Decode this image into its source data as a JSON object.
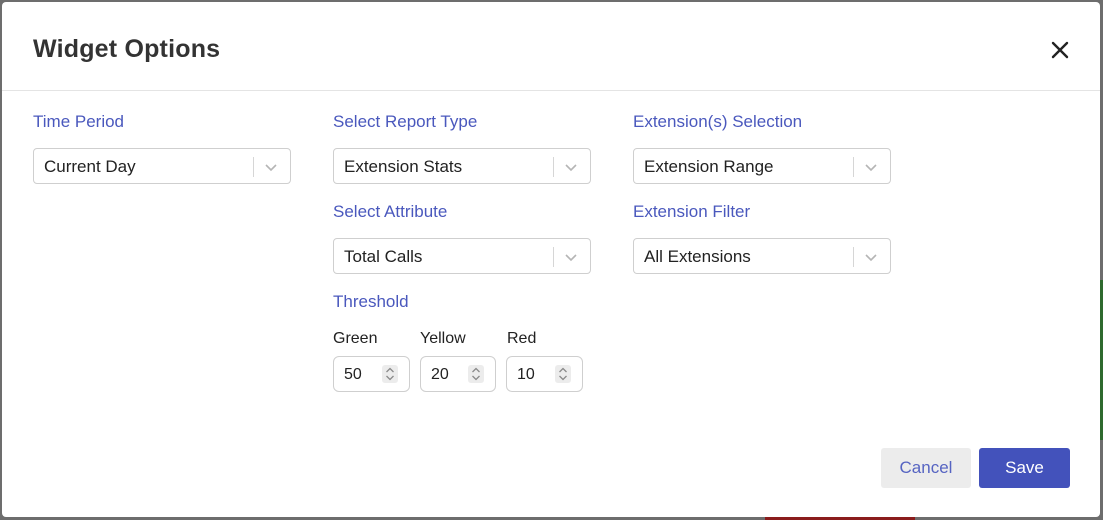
{
  "dialog": {
    "title": "Widget Options"
  },
  "time_period": {
    "label": "Time Period",
    "value": "Current Day"
  },
  "report_type": {
    "label": "Select Report Type",
    "value": "Extension Stats"
  },
  "attribute": {
    "label": "Select Attribute",
    "value": "Total Calls"
  },
  "extension_selection": {
    "label": "Extension(s) Selection",
    "value": "Extension Range"
  },
  "extension_filter": {
    "label": "Extension Filter",
    "value": "All Extensions"
  },
  "threshold": {
    "label": "Threshold",
    "green": {
      "label": "Green",
      "value": "50"
    },
    "yellow": {
      "label": "Yellow",
      "value": "20"
    },
    "red": {
      "label": "Red",
      "value": "10"
    }
  },
  "footer": {
    "cancel_label": "Cancel",
    "save_label": "Save"
  },
  "colors": {
    "accent": "#4352bb",
    "label": "#4a58bd",
    "cancel_bg": "#ececec"
  }
}
